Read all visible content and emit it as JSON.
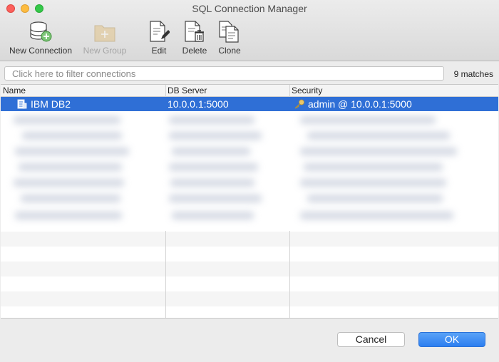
{
  "window": {
    "title": "SQL Connection Manager"
  },
  "toolbar": {
    "new_connection": "New Connection",
    "new_group": "New Group",
    "edit": "Edit",
    "delete": "Delete",
    "clone": "Clone"
  },
  "filter": {
    "placeholder": "Click here to filter connections",
    "value": "",
    "matches": "9 matches"
  },
  "table": {
    "columns": [
      "Name",
      "DB Server",
      "Security"
    ],
    "rows": [
      {
        "name": "IBM DB2",
        "server": "10.0.0.1:5000",
        "security": "admin @ 10.0.0.1:5000",
        "selected": true
      }
    ]
  },
  "footer": {
    "cancel": "Cancel",
    "ok": "OK"
  },
  "colors": {
    "selection": "#2f6fd6",
    "ok_button": "#2c7ef0"
  }
}
